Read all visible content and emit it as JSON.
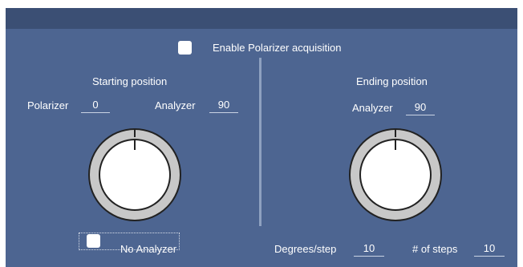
{
  "enable": {
    "label": "Enable Polarizer acquisition",
    "checked": false
  },
  "starting": {
    "title": "Starting position",
    "polarizer_label": "Polarizer",
    "polarizer_value": "0",
    "analyzer_label": "Analyzer",
    "analyzer_value": "90"
  },
  "ending": {
    "title": "Ending position",
    "analyzer_label": "Analyzer",
    "analyzer_value": "90"
  },
  "no_analyzer": {
    "label": "No Analyzer",
    "checked": false
  },
  "degrees_step": {
    "label": "Degrees/step",
    "value": "10"
  },
  "num_steps": {
    "label": "# of steps",
    "value": "10"
  },
  "colors": {
    "panel": "#4d6591",
    "topbar": "#3b4f74",
    "dial_ring": "#c8c8c8",
    "dial_face": "#ffffff"
  }
}
